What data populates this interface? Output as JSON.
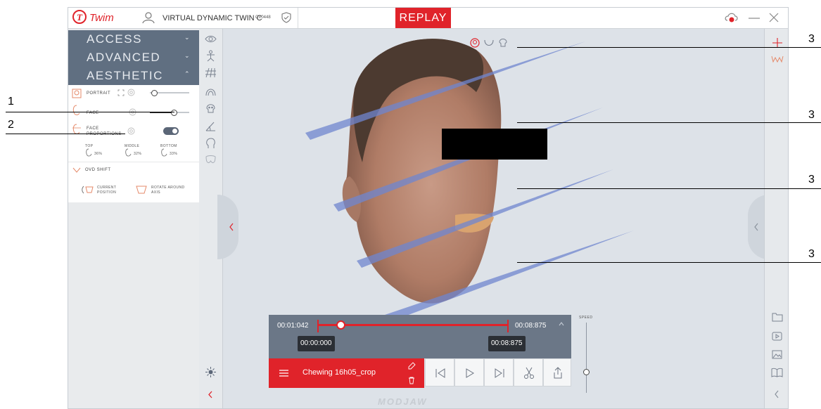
{
  "app": {
    "logo_letter": "T",
    "logo_text": "Twim",
    "device_name": "VIRTUAL DYNAMIC TWIN C",
    "device_code": "CV0448",
    "mode_label": "REPLAY",
    "watermark": "MODJAW"
  },
  "sidebar": {
    "sections": [
      {
        "label": "ACCESS",
        "expanded": false
      },
      {
        "label": "ADVANCED",
        "expanded": false
      },
      {
        "label": "AESTHETIC",
        "expanded": true
      }
    ],
    "aesthetic": {
      "portrait_label": "PORTRAIT",
      "face_label": "FACE",
      "face_proportions_label": "FACE PROPORTIONS",
      "face_proportions_line1": "FACE",
      "face_proportions_line2": "PROPORTIONS",
      "face_proportions_on": true,
      "proportions": [
        {
          "label": "TOP",
          "value": "36%"
        },
        {
          "label": "MIDDLE",
          "value": "32%"
        },
        {
          "label": "BOTTOM",
          "value": "33%"
        }
      ],
      "ovd_shift_label": "OVD SHIFT",
      "current_position_line1": "CURRENT",
      "current_position_line2": "POSITION",
      "rotate_axis_line1": "ROTATE AROUND",
      "rotate_axis_line2": "AXIS",
      "portrait_slider": 0.1,
      "face_slider": 0.6
    }
  },
  "player": {
    "current_time": "00:01:042",
    "end_time": "00:08:875",
    "trim_start": "00:00:000",
    "trim_end": "00:08:875",
    "clip_name": "Chewing 16h05_crop",
    "progress": 0.12,
    "speed_label": "SPEED",
    "speed_level": 0.3
  },
  "callouts": [
    "1",
    "2",
    "3",
    "3",
    "3",
    "3"
  ],
  "colors": {
    "accent": "#e0232a",
    "sidebar_header": "#606f81",
    "viewport": "#dde2e8",
    "plane": "#6f86cf",
    "timeline": "#6b7787"
  }
}
